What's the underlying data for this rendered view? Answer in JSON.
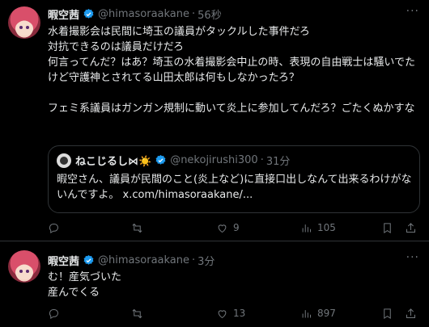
{
  "post1": {
    "name": "暇空茜",
    "handle": "@himasoraakane",
    "time": "56秒",
    "text": "水着撮影会は民間に埼玉の議員がタックルした事件だろ\n対抗できるのは議員だけだろ\n何言ってんだ？はあ？埼玉の水着撮影会中止の時、表現の自由戦士は騒いでたけど守護神とされてる山田太郎は何もしなかったろ？\n\nフェミ系議員はガンガン規制に動いて炎上に参加してんだろ？ごたくぬかすな",
    "quote": {
      "name": "ねこじるし⋈☀️",
      "handle": "@nekojirushi300",
      "time": "31分",
      "text": "暇空さん、議員が民間のこと(炎上など)に直接口出しなんて出来るわけがないんですよ。",
      "link": "x.com/himasoraakane/..."
    },
    "stats": {
      "replies": "",
      "reposts": "",
      "likes": "9",
      "views": "105"
    }
  },
  "post2": {
    "name": "暇空茜",
    "handle": "@himasoraakane",
    "time": "3分",
    "text": "む！産気づいた\n産んでくる",
    "stats": {
      "replies": "",
      "reposts": "",
      "likes": "13",
      "views": "897"
    }
  },
  "ui": {
    "dot": "·",
    "more": "···",
    "link_sep": " "
  },
  "colors": {
    "background": "#000000",
    "text": "#e7e9ea",
    "muted": "#71767b",
    "verified": "#1d9bf0",
    "border": "#2f3336"
  }
}
